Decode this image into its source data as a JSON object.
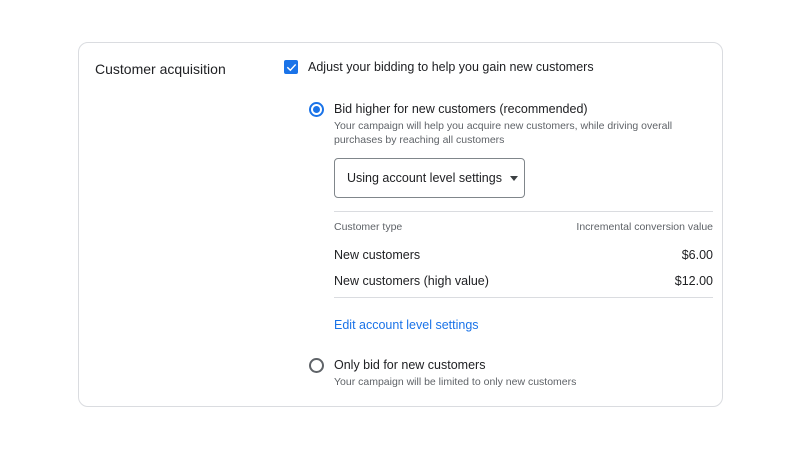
{
  "section": {
    "title": "Customer acquisition"
  },
  "checkbox": {
    "label": "Adjust your bidding to help you gain new customers",
    "checked": true
  },
  "options": [
    {
      "label": "Bid higher for new customers (recommended)",
      "description": "Your campaign will help you acquire new customers, while driving overall purchases by reaching all customers",
      "selected": true
    },
    {
      "label": "Only bid for new customers",
      "description": "Your campaign will be limited to only new customers",
      "selected": false
    }
  ],
  "dropdown": {
    "selected": "Using account level settings"
  },
  "table": {
    "headers": [
      "Customer type",
      "Incremental conversion value"
    ],
    "rows": [
      [
        "New customers",
        "$6.00"
      ],
      [
        "New customers (high value)",
        "$12.00"
      ]
    ]
  },
  "link": {
    "label": "Edit account level settings"
  },
  "colors": {
    "accent": "#1a73e8",
    "border": "#dadce0",
    "secondary_text": "#5f6368"
  }
}
